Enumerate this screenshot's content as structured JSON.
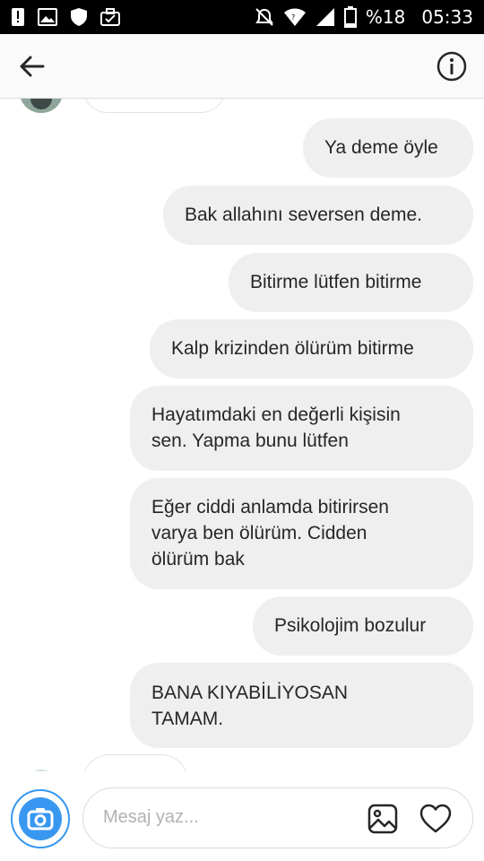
{
  "status_bar": {
    "battery_percent": "%18",
    "time": "05:33",
    "icons": [
      "alert-icon",
      "image-icon",
      "shield-icon",
      "briefcase-icon",
      "mute-icon",
      "wifi-icon",
      "signal-icon",
      "battery-icon"
    ]
  },
  "header": {
    "back_icon": "arrow-left-icon",
    "info_icon": "info-icon"
  },
  "messages": [
    {
      "side": "right",
      "lines": [
        "Ya deme öyle"
      ]
    },
    {
      "side": "right",
      "lines": [
        "Bak allahını seversen deme."
      ]
    },
    {
      "side": "right",
      "lines": [
        "Bitirme lütfen bitirme"
      ]
    },
    {
      "side": "right",
      "lines": [
        "Kalp krizinden ölürüm bitirme"
      ]
    },
    {
      "side": "right",
      "lines": [
        "Hayatımdaki en değerli kişisin",
        "sen. Yapma bunu lütfen"
      ]
    },
    {
      "side": "right",
      "lines": [
        "Eğer ciddi anlamda bitirirsen",
        "varya ben ölürüm. Cidden",
        "ölürüm bak"
      ]
    },
    {
      "side": "right",
      "lines": [
        "Psikolojim bozulur"
      ]
    },
    {
      "side": "right",
      "lines": [
        "BANA KIYABİLİYOSAN",
        "TAMAM."
      ]
    }
  ],
  "composer": {
    "placeholder": "Mesaj yaz...",
    "camera_icon": "camera-icon",
    "gallery_icon": "gallery-icon",
    "heart_icon": "heart-icon"
  },
  "colors": {
    "bubble": "#efefef",
    "accent": "#3897f0",
    "text": "#262626"
  }
}
